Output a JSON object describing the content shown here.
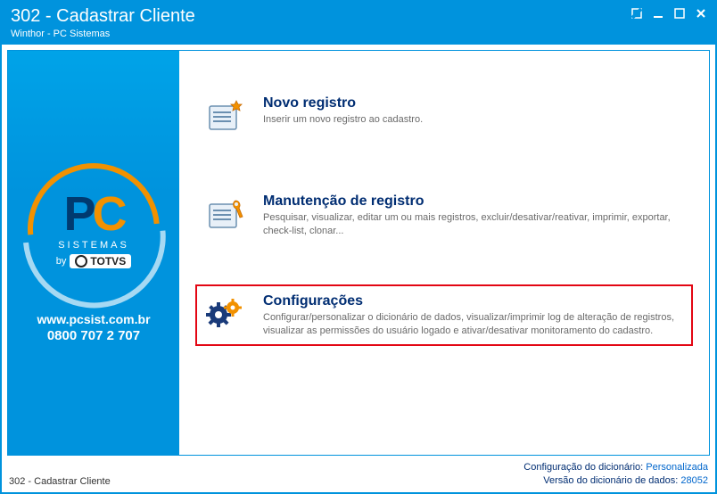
{
  "window": {
    "title": "302 - Cadastrar Cliente",
    "subtitle": "Winthor - PC Sistemas"
  },
  "sidebar": {
    "logo_letters_p": "P",
    "logo_letters_c": "C",
    "logo_sistemas": "SISTEMAS",
    "logo_by": "by",
    "logo_totvs": "TOTVS",
    "url": "www.pcsist.com.br",
    "phone": "0800 707 2 707"
  },
  "options": [
    {
      "title": "Novo registro",
      "desc": "Inserir um novo registro ao cadastro.",
      "icon": "new-record-icon",
      "highlight": false
    },
    {
      "title": "Manutenção de registro",
      "desc": "Pesquisar, visualizar, editar um ou mais registros, excluir/desativar/reativar, imprimir, exportar, check-list,  clonar...",
      "icon": "maintain-record-icon",
      "highlight": false
    },
    {
      "title": "Configurações",
      "desc": "Configurar/personalizar o dicionário de dados, visualizar/imprimir log de alteração de registros, visualizar as permissões do usuário logado e ativar/desativar monitoramento do cadastro.",
      "icon": "settings-icon",
      "highlight": true
    }
  ],
  "status": {
    "left": "302 - Cadastrar Cliente",
    "config_label": "Configuração do dicionário:",
    "config_value": "Personalizada",
    "version_label": "Versão do dicionário de dados:",
    "version_value": "28052"
  }
}
